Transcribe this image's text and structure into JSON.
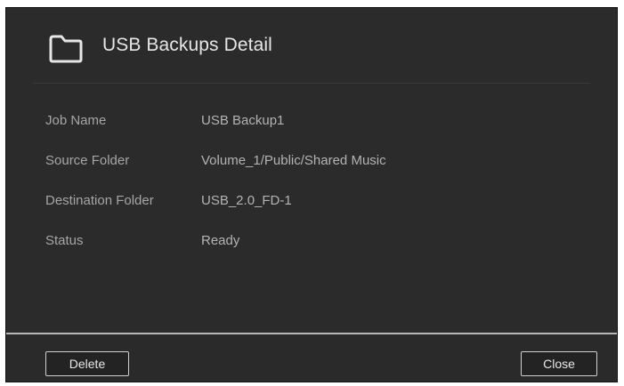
{
  "dialog": {
    "title": "USB Backups Detail",
    "icon": "folder-icon"
  },
  "details": [
    {
      "label": "Job Name",
      "value": "USB Backup1"
    },
    {
      "label": "Source Folder",
      "value": "Volume_1/Public/Shared Music"
    },
    {
      "label": "Destination Folder",
      "value": "USB_2.0_FD-1"
    },
    {
      "label": "Status",
      "value": "Ready"
    }
  ],
  "footer": {
    "delete_label": "Delete",
    "close_label": "Close"
  },
  "colors": {
    "dialog_background": "#2b2b2b",
    "title_text": "#e6e6e6",
    "label_text": "#a6a6a6",
    "footer_divider": "#b8b8b8"
  }
}
